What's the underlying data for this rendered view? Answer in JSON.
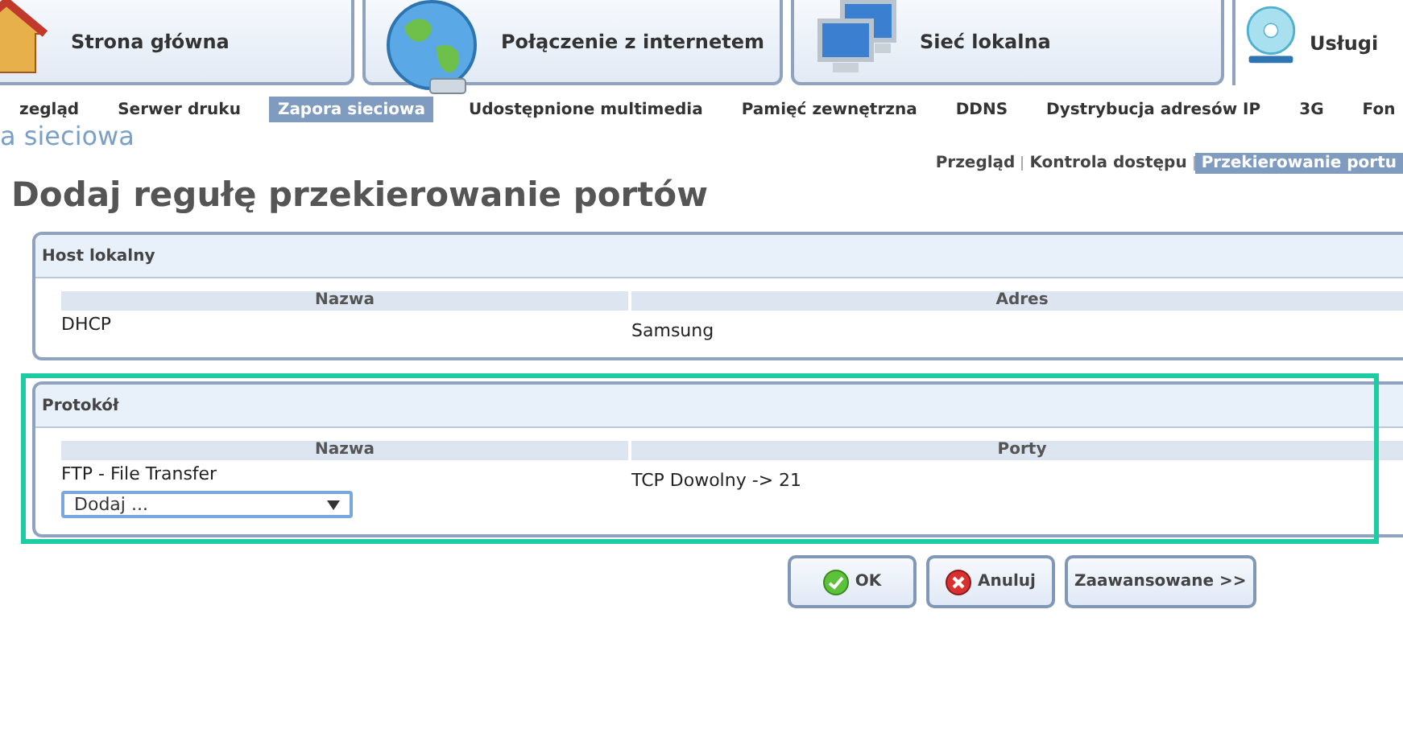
{
  "top_tabs": [
    {
      "label": "Strona główna",
      "selected": false
    },
    {
      "label": "Połączenie z internetem",
      "selected": false
    },
    {
      "label": "Sieć lokalna",
      "selected": false
    },
    {
      "label": "Usługi",
      "selected": true
    }
  ],
  "sub_tabs": [
    {
      "label": "zegląd",
      "selected": false
    },
    {
      "label": "Serwer druku",
      "selected": false
    },
    {
      "label": "Zapora sieciowa",
      "selected": true
    },
    {
      "label": "Udostępnione multimedia",
      "selected": false
    },
    {
      "label": "Pamięć zewnętrzna",
      "selected": false
    },
    {
      "label": "DDNS",
      "selected": false
    },
    {
      "label": "Dystrybucja adresów IP",
      "selected": false
    },
    {
      "label": "3G",
      "selected": false
    },
    {
      "label": "Fon",
      "selected": false
    }
  ],
  "breadcrumb": "a sieciowa",
  "page_links": [
    {
      "label": "Przegląd",
      "selected": false
    },
    {
      "label": "Kontrola dostępu",
      "selected": false
    },
    {
      "label": "Przekierowanie portu",
      "selected": true
    }
  ],
  "title": "Dodaj regułę przekierowanie portów",
  "sections": [
    {
      "title": "Host lokalny",
      "highlighted": false,
      "columns": [
        "Nazwa",
        "Adres"
      ],
      "rows": [
        [
          "DHCP",
          "Samsung"
        ]
      ]
    },
    {
      "title": "Protokół",
      "highlighted": true,
      "columns": [
        "Nazwa",
        "Porty"
      ],
      "rows": [
        [
          "FTP - File Transfer",
          "TCP Dowolny -> 21"
        ]
      ],
      "select": {
        "value": "Dodaj ..."
      }
    }
  ],
  "buttons": [
    {
      "label": "OK",
      "kind": "ok"
    },
    {
      "label": "Anuluj",
      "kind": "cancel"
    },
    {
      "label": "Zaawansowane >>",
      "kind": "plain"
    }
  ]
}
